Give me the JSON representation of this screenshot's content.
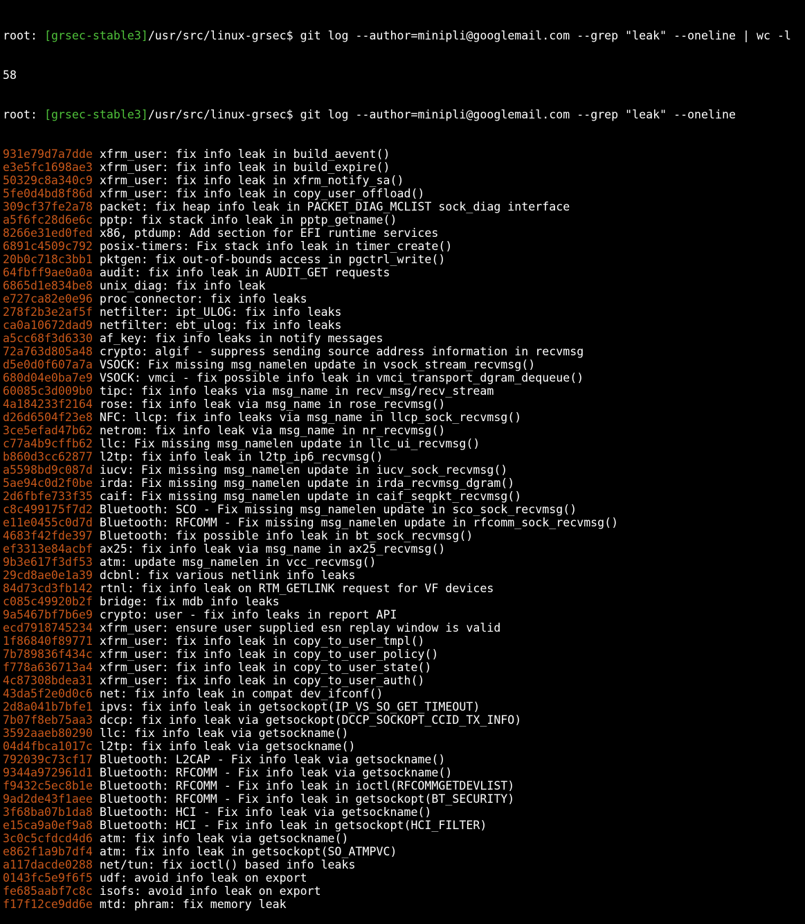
{
  "terminal": {
    "prompt_user": "root: ",
    "prompt_branch": "[grsec-stable3]",
    "prompt_path": "/usr/src/linux-grsec$ ",
    "command1": "git log --author=minipli@googlemail.com --grep \"leak\" --oneline | wc -l",
    "count_output": "58",
    "command2": "git log --author=minipli@googlemail.com --grep \"leak\" --oneline",
    "colors": {
      "background": "#000000",
      "text": "#ffffff",
      "branch": "#4fc13a",
      "hash": "#c8571a"
    }
  },
  "commits": [
    {
      "hash": "931e79d7a7dde",
      "message": "xfrm_user: fix info leak in build_aevent()"
    },
    {
      "hash": "e3e5fc1698ae3",
      "message": "xfrm_user: fix info leak in build_expire()"
    },
    {
      "hash": "50329c8a340c9",
      "message": "xfrm_user: fix info leak in xfrm_notify_sa()"
    },
    {
      "hash": "5fe0d4bd8f86d",
      "message": "xfrm_user: fix info leak in copy_user_offload()"
    },
    {
      "hash": "309cf37fe2a78",
      "message": "packet: fix heap info leak in PACKET_DIAG_MCLIST sock_diag interface"
    },
    {
      "hash": "a5f6fc28d6e6c",
      "message": "pptp: fix stack info leak in pptp_getname()"
    },
    {
      "hash": "8266e31ed0fed",
      "message": "x86, ptdump: Add section for EFI runtime services"
    },
    {
      "hash": "6891c4509c792",
      "message": "posix-timers: Fix stack info leak in timer_create()"
    },
    {
      "hash": "20b0c718c3bb1",
      "message": "pktgen: fix out-of-bounds access in pgctrl_write()"
    },
    {
      "hash": "64fbff9ae0a0a",
      "message": "audit: fix info leak in AUDIT_GET requests"
    },
    {
      "hash": "6865d1e834be8",
      "message": "unix_diag: fix info leak"
    },
    {
      "hash": "e727ca82e0e96",
      "message": "proc connector: fix info leaks"
    },
    {
      "hash": "278f2b3e2af5f",
      "message": "netfilter: ipt_ULOG: fix info leaks"
    },
    {
      "hash": "ca0a10672dad9",
      "message": "netfilter: ebt_ulog: fix info leaks"
    },
    {
      "hash": "a5cc68f3d6330",
      "message": "af_key: fix info leaks in notify messages"
    },
    {
      "hash": "72a763d805a48",
      "message": "crypto: algif - suppress sending source address information in recvmsg"
    },
    {
      "hash": "d5e0d0f607a7a",
      "message": "VSOCK: Fix missing msg_namelen update in vsock_stream_recvmsg()"
    },
    {
      "hash": "680d04e0ba7e9",
      "message": "VSOCK: vmci - fix possible info leak in vmci_transport_dgram_dequeue()"
    },
    {
      "hash": "60085c3d009b0",
      "message": "tipc: fix info leaks via msg_name in recv_msg/recv_stream"
    },
    {
      "hash": "4a184233f2164",
      "message": "rose: fix info leak via msg_name in rose_recvmsg()"
    },
    {
      "hash": "d26d6504f23e8",
      "message": "NFC: llcp: fix info leaks via msg_name in llcp_sock_recvmsg()"
    },
    {
      "hash": "3ce5efad47b62",
      "message": "netrom: fix info leak via msg_name in nr_recvmsg()"
    },
    {
      "hash": "c77a4b9cffb62",
      "message": "llc: Fix missing msg_namelen update in llc_ui_recvmsg()"
    },
    {
      "hash": "b860d3cc62877",
      "message": "l2tp: fix info leak in l2tp_ip6_recvmsg()"
    },
    {
      "hash": "a5598bd9c087d",
      "message": "iucv: Fix missing msg_namelen update in iucv_sock_recvmsg()"
    },
    {
      "hash": "5ae94c0d2f0be",
      "message": "irda: Fix missing msg_namelen update in irda_recvmsg_dgram()"
    },
    {
      "hash": "2d6fbfe733f35",
      "message": "caif: Fix missing msg_namelen update in caif_seqpkt_recvmsg()"
    },
    {
      "hash": "c8c499175f7d2",
      "message": "Bluetooth: SCO - Fix missing msg_namelen update in sco_sock_recvmsg()"
    },
    {
      "hash": "e11e0455c0d7d",
      "message": "Bluetooth: RFCOMM - Fix missing msg_namelen update in rfcomm_sock_recvmsg()"
    },
    {
      "hash": "4683f42fde397",
      "message": "Bluetooth: fix possible info leak in bt_sock_recvmsg()"
    },
    {
      "hash": "ef3313e84acbf",
      "message": "ax25: fix info leak via msg_name in ax25_recvmsg()"
    },
    {
      "hash": "9b3e617f3df53",
      "message": "atm: update msg_namelen in vcc_recvmsg()"
    },
    {
      "hash": "29cd8ae0e1a39",
      "message": "dcbnl: fix various netlink info leaks"
    },
    {
      "hash": "84d73cd3fb142",
      "message": "rtnl: fix info leak on RTM_GETLINK request for VF devices"
    },
    {
      "hash": "c085c49920b2f",
      "message": "bridge: fix mdb info leaks"
    },
    {
      "hash": "9a5467bf7b6e9",
      "message": "crypto: user - fix info leaks in report API"
    },
    {
      "hash": "ecd7918745234",
      "message": "xfrm_user: ensure user supplied esn replay window is valid"
    },
    {
      "hash": "1f86840f89771",
      "message": "xfrm_user: fix info leak in copy_to_user_tmpl()"
    },
    {
      "hash": "7b789836f434c",
      "message": "xfrm_user: fix info leak in copy_to_user_policy()"
    },
    {
      "hash": "f778a636713a4",
      "message": "xfrm_user: fix info leak in copy_to_user_state()"
    },
    {
      "hash": "4c87308bdea31",
      "message": "xfrm_user: fix info leak in copy_to_user_auth()"
    },
    {
      "hash": "43da5f2e0d0c6",
      "message": "net: fix info leak in compat dev_ifconf()"
    },
    {
      "hash": "2d8a041b7bfe1",
      "message": "ipvs: fix info leak in getsockopt(IP_VS_SO_GET_TIMEOUT)"
    },
    {
      "hash": "7b07f8eb75aa3",
      "message": "dccp: fix info leak via getsockopt(DCCP_SOCKOPT_CCID_TX_INFO)"
    },
    {
      "hash": "3592aaeb80290",
      "message": "llc: fix info leak via getsockname()"
    },
    {
      "hash": "04d4fbca1017c",
      "message": "l2tp: fix info leak via getsockname()"
    },
    {
      "hash": "792039c73cf17",
      "message": "Bluetooth: L2CAP - Fix info leak via getsockname()"
    },
    {
      "hash": "9344a972961d1",
      "message": "Bluetooth: RFCOMM - Fix info leak via getsockname()"
    },
    {
      "hash": "f9432c5ec8b1e",
      "message": "Bluetooth: RFCOMM - Fix info leak in ioctl(RFCOMMGETDEVLIST)"
    },
    {
      "hash": "9ad2de43f1aee",
      "message": "Bluetooth: RFCOMM - Fix info leak in getsockopt(BT_SECURITY)"
    },
    {
      "hash": "3f68ba07b1da8",
      "message": "Bluetooth: HCI - Fix info leak via getsockname()"
    },
    {
      "hash": "e15ca9a0ef9a8",
      "message": "Bluetooth: HCI - Fix info leak in getsockopt(HCI_FILTER)"
    },
    {
      "hash": "3c0c5cfdcd4d6",
      "message": "atm: fix info leak via getsockname()"
    },
    {
      "hash": "e862f1a9b7df4",
      "message": "atm: fix info leak in getsockopt(SO_ATMPVC)"
    },
    {
      "hash": "a117dacde0288",
      "message": "net/tun: fix ioctl() based info leaks"
    },
    {
      "hash": "0143fc5e9f6f5",
      "message": "udf: avoid info leak on export"
    },
    {
      "hash": "fe685aabf7c8c",
      "message": "isofs: avoid info leak on export"
    },
    {
      "hash": "f17f12ce9dd6e",
      "message": "mtd: phram: fix memory leak"
    }
  ]
}
